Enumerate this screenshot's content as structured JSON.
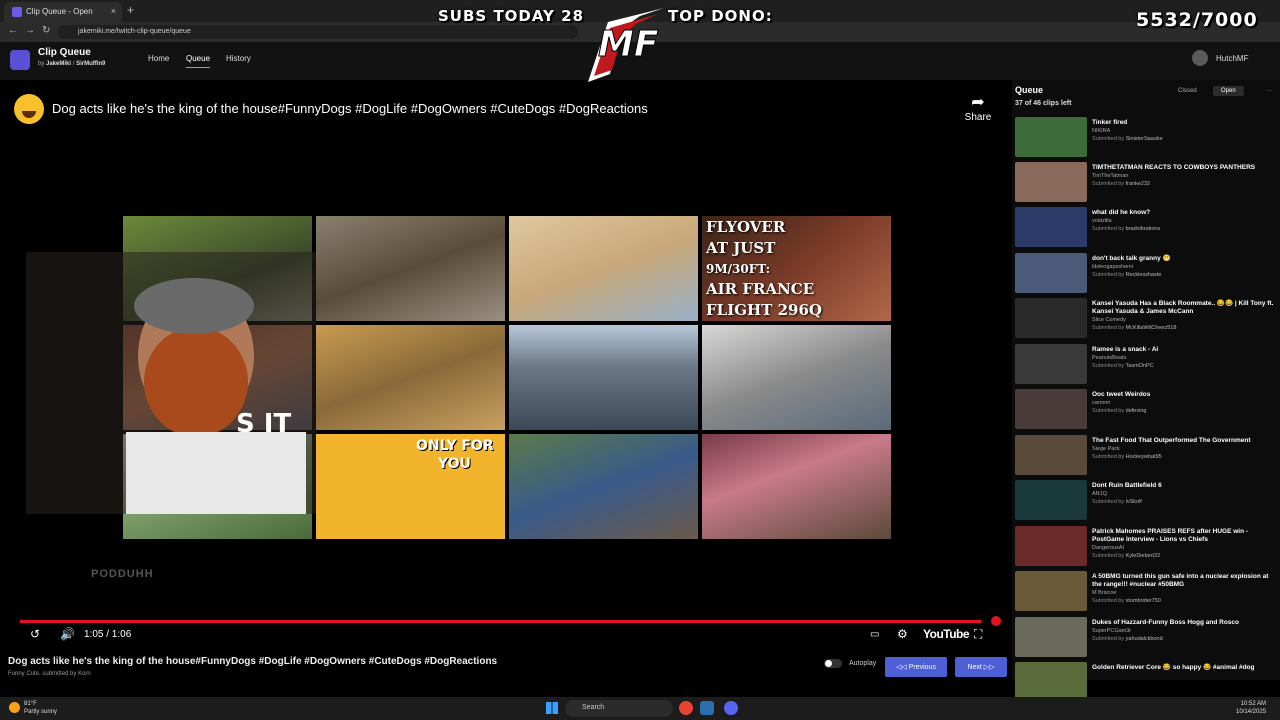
{
  "browser": {
    "tab_title": "Clip Queue - Open",
    "tab_close": "×",
    "new_tab": "+",
    "url": "jakemiki.me/twitch-clip-queue/queue"
  },
  "overlay": {
    "subs_today": "SUBS TODAY 28",
    "top_dono": "TOP DONO:",
    "sub_goal": "5532/7000",
    "logo_text": "MF"
  },
  "app": {
    "title": "Clip Queue",
    "by": "by",
    "author": "JakeMiki",
    "sep": "/",
    "channel": "SirMuffin9",
    "nav": [
      "Home",
      "Queue",
      "History"
    ],
    "username": "HutchMF"
  },
  "player": {
    "title": "Dog acts like he's the king of the house#FunnyDogs #DogLife #DogOwners #CuteDogs #DogReactions",
    "share_label": "Share",
    "flyover_text": [
      "FLYOVER",
      "AT JUST",
      "9M/30FT:",
      "AIR FRANCE",
      "FLIGHT 296Q"
    ],
    "only_for_you": [
      "ONLY FOR",
      "YOU"
    ],
    "cam_text": "S IT",
    "watermark": "PODDUHH",
    "time": "1:05 / 1:06",
    "progress": 0.985,
    "youtube_label": "YouTube"
  },
  "video_info": {
    "title": "Dog acts like he's the king of the house#FunnyDogs #DogLife #DogOwners #CuteDogs #DogReactions",
    "channel": "Funny Cute",
    "submitted_by_text": ", submitted by",
    "submitter": "Korn"
  },
  "controls": {
    "autoplay_label": "Autoplay",
    "previous_label": "Previous",
    "next_label": "Next"
  },
  "queue": {
    "title": "Queue",
    "clips_left": "37 of 46 clips left",
    "closed_label": "Closed",
    "open_label": "Open",
    "more": "···",
    "submitted_by_label": "Submitted by",
    "items": [
      {
        "title": "Tinker fired",
        "channel": "NIKIRA",
        "submitter": "SinisterSasube",
        "color": "#3d6b3a"
      },
      {
        "title": "TIMTHETATMAN REACTS TO COWBOYS PANTHERS",
        "channel": "TimTheTatman",
        "submitter": "franke232",
        "color": "#8a6a5a"
      },
      {
        "title": "what did he know?",
        "channel": "voidzilla",
        "submitter": "bradvibrations",
        "color": "#2d3b6b"
      },
      {
        "title": "don't back talk granny 😬",
        "channel": "ldsleogapsshemi",
        "submitter": "Recklesshaste",
        "color": "#4a5a78"
      },
      {
        "title": "Kansei Yasuda Has a Black Roommate.. 😂😂 | Kill Tony ft. Kansei Yasuda & James McCann",
        "channel": "Slice Comedy",
        "submitter": "McKillaWitCheez518",
        "color": "#2a2a2a"
      },
      {
        "title": "Ramee is a snack - Ai",
        "channel": "PeanutsBeats",
        "submitter": "TasmOnPC",
        "color": "#3a3a3a"
      },
      {
        "title": "Ooc tweet Weirdos",
        "channel": "carmnn",
        "submitter": "defexing",
        "color": "#4a3a3a"
      },
      {
        "title": "The Fast Food That Outperformed The Government",
        "channel": "Siege Pack",
        "submitter": "Hockeywhat95",
        "color": "#5a4a3a"
      },
      {
        "title": "Dont Ruin Battlefield 6",
        "channel": "AN1Q",
        "submitter": "lvSkolf",
        "color": "#1a3a3a"
      },
      {
        "title": "Patrick Mahomes PRAISES REFS after HUGE win - PostGame Interview - Lions vs Chiefs",
        "channel": "DangerousAI",
        "submitter": "KyleDiebert22",
        "color": "#6a2a2a"
      },
      {
        "title": "A 50BMG turned this gun safe into a nuclear explosion at the range!!! #nuclear #50BMG",
        "channel": "M Briscoe",
        "submitter": "stumbrider750",
        "color": "#6a5a3a"
      },
      {
        "title": "Dukes of Hazzard-Funny Boss Hogg and Rosco",
        "channel": "SuperPCGam3r",
        "submitter": "yahudalckbond",
        "color": "#6a6a5a"
      },
      {
        "title": "Golden Retriever Core 😂 so happy 😂 #animal #dog",
        "channel": "",
        "submitter": "",
        "color": "#5a6a3a"
      }
    ]
  },
  "taskbar": {
    "temp": "81°F",
    "weather": "Partly sunny",
    "search_label": "Search",
    "time": "10:52 AM",
    "date": "10/14/2025"
  }
}
